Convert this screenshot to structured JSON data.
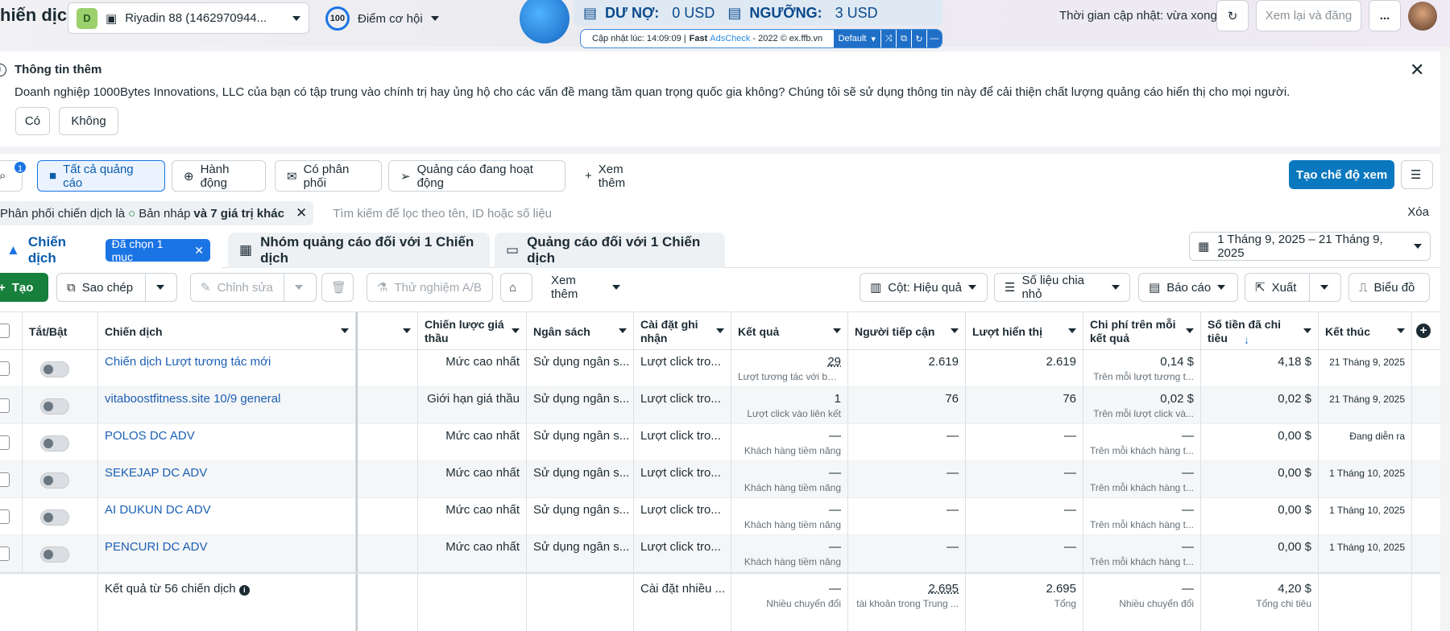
{
  "header": {
    "title": "hiến dịch",
    "account_badge": "D",
    "account_name": "Riyadin 88 (1462970944...",
    "opportunity_score": "100",
    "opportunity_label": "Điểm cơ hội",
    "update_time_text": "Thời gian cập nhật: vừa xong",
    "review_publish_label": "Xem lại và đăng",
    "more_label": "..."
  },
  "adscheck": {
    "debt_label": "DƯ NỢ:",
    "debt_value": "0 USD",
    "threshold_label": "NGƯỠNG:",
    "threshold_value": "3 USD",
    "updated_text": "Cập nhật lúc: 14:09:09 |",
    "fast_label": "Fast",
    "brand_label": "AdsCheck",
    "copyright_text": "- 2022 © ex.ffb.vn",
    "preset_label": "Default"
  },
  "banner": {
    "title": "Thông tin thêm",
    "text": "Doanh nghiệp 1000Bytes Innovations, LLC của bạn có tập trung vào chính trị hay ủng hộ cho các vấn đề mang tầm quan trọng quốc gia không? Chúng tôi sẽ sử dụng thông tin này để cải thiện chất lượng quảng cáo hiển thị cho mọi người.",
    "yes_label": "Có",
    "no_label": "Không"
  },
  "views": {
    "search_badge": "1",
    "all_ads": "Tất cả quảng cáo",
    "actions": "Hành động",
    "has_delivery": "Có phân phối",
    "active_ads": "Quảng cáo đang hoạt động",
    "see_more": "Xem thêm",
    "create_view": "Tạo chế độ xem"
  },
  "filter": {
    "chip_prefix": "Phân phối chiến dịch là",
    "chip_value": "Bản nháp",
    "chip_suffix": "và 7 giá trị khác",
    "search_placeholder": "Tìm kiếm để lọc theo tên, ID hoặc số liệu",
    "clear_label": "Xóa"
  },
  "tabs": {
    "campaigns": "Chiến dịch",
    "selected": "Đã chọn 1 mục",
    "adsets": "Nhóm quảng cáo đối với 1 Chiến dịch",
    "ads": "Quảng cáo đối với 1 Chiến dịch",
    "date_range": "1 Tháng 9, 2025 – 21 Tháng 9, 2025"
  },
  "toolbar": {
    "create": "Tạo",
    "duplicate": "Sao chép",
    "edit": "Chỉnh sửa",
    "ab_test": "Thử nghiệm A/B",
    "more": "Xem thêm",
    "columns": "Cột: Hiệu quả",
    "breakdown": "Số liệu chia nhỏ",
    "reports": "Báo cáo",
    "export": "Xuất",
    "charts": "Biểu đồ"
  },
  "table": {
    "headers": {
      "toggle": "Tắt/Bật",
      "campaign": "Chiến dịch",
      "bid_strategy": "Chiến lược giá thầu",
      "budget": "Ngân sách",
      "attribution": "Cài đặt ghi nhận",
      "results": "Kết quả",
      "reach": "Người tiếp cận",
      "impressions": "Lượt hiển thị",
      "cost_per_result": "Chi phí trên mỗi kết quả",
      "amount_spent": "Số tiền đã chi tiêu",
      "ends": "Kết thúc"
    },
    "rows": [
      {
        "name": "Chiến dịch Lượt tương tác mới",
        "bid": "Mức cao nhất",
        "budget": "Sử dụng ngân s...",
        "attribution": "Lượt click tro...",
        "results": "29",
        "results_sub": "Lượt tương tác với bài...",
        "reach": "2.619",
        "impressions": "2.619",
        "cpr": "0,14 $",
        "cpr_sub": "Trên mỗi lượt tương t...",
        "spent": "4,18 $",
        "ends": "21 Tháng 9, 2025"
      },
      {
        "name": "vitaboostfitness.site 10/9 general",
        "bid": "Giới hạn giá thầu",
        "budget": "Sử dụng ngân s...",
        "attribution": "Lượt click tro...",
        "results": "1",
        "results_sub": "Lượt click vào liên kết",
        "reach": "76",
        "impressions": "76",
        "cpr": "0,02 $",
        "cpr_sub": "Trên mỗi lượt click và...",
        "spent": "0,02 $",
        "ends": "21 Tháng 9, 2025"
      },
      {
        "name": "POLOS DC ADV",
        "bid": "Mức cao nhất",
        "budget": "Sử dụng ngân s...",
        "attribution": "Lượt click tro...",
        "results": "—",
        "results_sub": "Khách hàng tiềm năng",
        "reach": "—",
        "impressions": "—",
        "cpr": "—",
        "cpr_sub": "Trên mỗi khách hàng t...",
        "spent": "0,00 $",
        "ends": "Đang diễn ra"
      },
      {
        "name": "SEKEJAP DC ADV",
        "bid": "Mức cao nhất",
        "budget": "Sử dụng ngân s...",
        "attribution": "Lượt click tro...",
        "results": "—",
        "results_sub": "Khách hàng tiềm năng",
        "reach": "—",
        "impressions": "—",
        "cpr": "—",
        "cpr_sub": "Trên mỗi khách hàng t...",
        "spent": "0,00 $",
        "ends": "1 Tháng 10, 2025"
      },
      {
        "name": "AI DUKUN DC ADV",
        "bid": "Mức cao nhất",
        "budget": "Sử dụng ngân s...",
        "attribution": "Lượt click tro...",
        "results": "—",
        "results_sub": "Khách hàng tiềm năng",
        "reach": "—",
        "impressions": "—",
        "cpr": "—",
        "cpr_sub": "Trên mỗi khách hàng t...",
        "spent": "0,00 $",
        "ends": "1 Tháng 10, 2025"
      },
      {
        "name": "PENCURI DC ADV",
        "bid": "Mức cao nhất",
        "budget": "Sử dụng ngân s...",
        "attribution": "Lượt click tro...",
        "results": "—",
        "results_sub": "Khách hàng tiềm năng",
        "reach": "—",
        "impressions": "—",
        "cpr": "—",
        "cpr_sub": "Trên mỗi khách hàng t...",
        "spent": "0,00 $",
        "ends": "1 Tháng 10, 2025"
      }
    ],
    "summary": {
      "label": "Kết quả từ 56 chiến dịch",
      "attribution": "Cài đặt nhiều ...",
      "results": "—",
      "results_sub": "Nhiều chuyển đổi",
      "reach": "2.695",
      "reach_sub": "tài khoản trong Trung ...",
      "impressions": "2.695",
      "impressions_sub": "Tổng",
      "cpr": "—",
      "cpr_sub": "Nhiều chuyển đổi",
      "spent": "4,20 $",
      "spent_sub": "Tổng chi tiêu"
    }
  }
}
